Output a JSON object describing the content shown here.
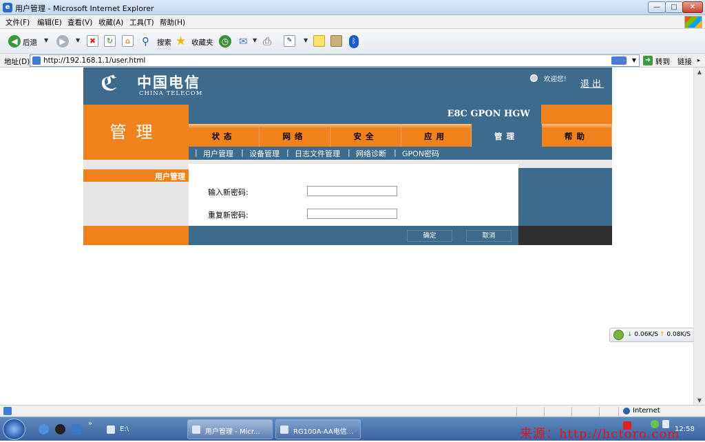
{
  "window": {
    "title": "用户管理 - Microsoft Internet Explorer"
  },
  "menubar": {
    "items": [
      "文件(F)",
      "编辑(E)",
      "查看(V)",
      "收藏(A)",
      "工具(T)",
      "帮助(H)"
    ]
  },
  "toolbar": {
    "back_label": "后退",
    "search_label": "搜索",
    "favorites_label": "收藏夹"
  },
  "address": {
    "label": "地址(D)",
    "url": "http://192.168.1.1/user.html",
    "go_label": "转到",
    "links_label": "链接"
  },
  "page": {
    "logo_cn": "中国电信",
    "logo_en": "CHINA TELECOM",
    "welcome": "欢迎您！",
    "logout": "退出",
    "section_title": "管理",
    "product": "E8C GPON HGW",
    "tabs": [
      "状态",
      "网络",
      "安全",
      "应用",
      "管理",
      "帮助"
    ],
    "active_tab": "管理",
    "subnav": [
      "用户管理",
      "设备管理",
      "日志文件管理",
      "网络诊断",
      "GPON密码"
    ],
    "left_item": "用户管理",
    "form": {
      "new_password_label": "输入新密码:",
      "repeat_password_label": "重复新密码:",
      "new_password_value": "",
      "repeat_password_value": ""
    },
    "buttons": {
      "ok": "确定",
      "cancel": "取消"
    }
  },
  "speed": {
    "down": "0.06K/S",
    "up": "0.08K/S"
  },
  "statusbar": {
    "zone": "Internet"
  },
  "taskbar": {
    "tasks": [
      "E:\\",
      "用户管理 - Micr...",
      "RG100A-AA电信..."
    ],
    "time": "12:58",
    "watermark": "来源：http://hctoro.com"
  }
}
